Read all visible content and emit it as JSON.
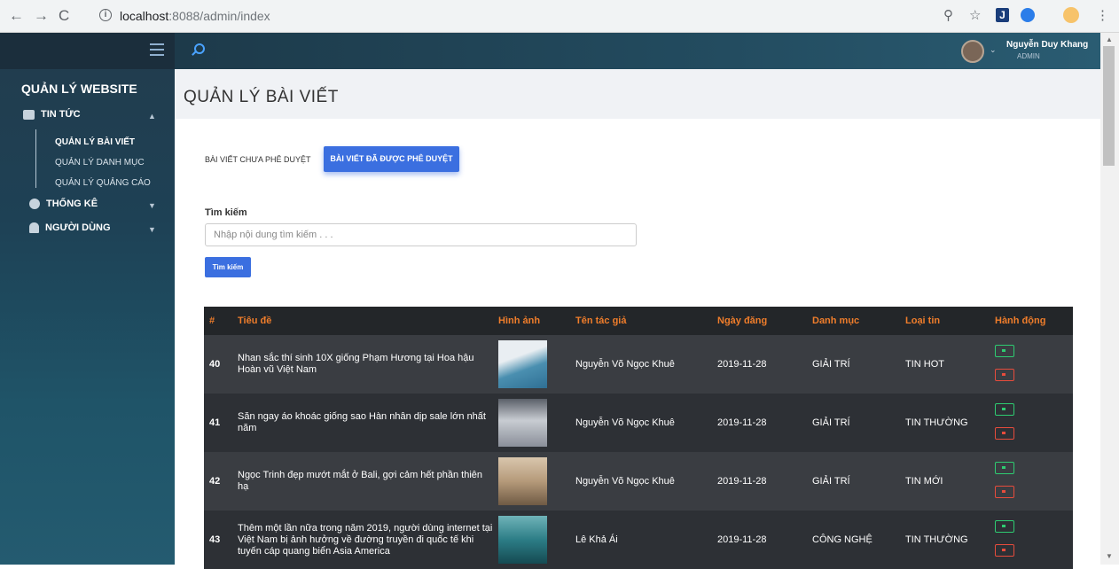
{
  "browser": {
    "url_host": "localhost",
    "url_path": ":8088/admin/index"
  },
  "sidebar": {
    "title": "QUẢN LÝ WEBSITE",
    "items": [
      {
        "label": "TIN TỨC"
      },
      {
        "label": "THỐNG KÊ"
      },
      {
        "label": "NGƯỜI DÙNG"
      }
    ],
    "sub_items": [
      {
        "label": "QUẢN LÝ BÀI VIẾT"
      },
      {
        "label": "QUẢN LÝ DANH MỤC"
      },
      {
        "label": "QUẢN LÝ QUẢNG CÁO"
      }
    ]
  },
  "topbar": {
    "user_name": "Nguyễn Duy Khang",
    "user_role": "ADMIN"
  },
  "main": {
    "page_title": "QUẢN LÝ BÀI VIẾT",
    "tab_pending": "BÀI VIẾT CHƯA PHÊ DUYỆT",
    "tab_approved": "BÀI VIẾT ĐÃ ĐƯỢC PHÊ DUYỆT",
    "search_label": "Tìm kiếm",
    "search_placeholder": "Nhập nội dung tìm kiếm . . .",
    "search_button": "Tìm kiếm"
  },
  "table": {
    "headers": [
      "#",
      "Tiêu đề",
      "Hình ảnh",
      "Tên tác giả",
      "Ngày đăng",
      "Danh mục",
      "Loại tin",
      "Hành động"
    ],
    "rows": [
      {
        "id": "40",
        "title": "Nhan sắc thí sinh 10X giống Phạm Hương tại Hoa hậu Hoàn vũ Việt Nam",
        "author": "Nguyễn Võ Ngọc Khuê",
        "date": "2019-11-28",
        "category": "GIẢI TRÍ",
        "type": "TIN HOT",
        "img_color": "#4a8fb0"
      },
      {
        "id": "41",
        "title": "Săn ngay áo khoác giống sao Hàn nhân dịp sale lớn nhất năm",
        "author": "Nguyễn Võ Ngọc Khuê",
        "date": "2019-11-28",
        "category": "GIẢI TRÍ",
        "type": "TIN THƯỜNG",
        "img_color": "#8a8f99"
      },
      {
        "id": "42",
        "title": "Ngọc Trinh đẹp mướt mắt ở Bali, gợi cảm hết phần thiên hạ",
        "author": "Nguyễn Võ Ngọc Khuê",
        "date": "2019-11-28",
        "category": "GIẢI TRÍ",
        "type": "TIN MỚI",
        "img_color": "#b59a7a"
      },
      {
        "id": "43",
        "title": "Thêm một lần nữa trong năm 2019, người dùng internet tại Việt Nam bị ảnh hưởng về đường truyền đi quốc tế khi tuyến cáp quang biển Asia America",
        "author": "Lê Khả Ái",
        "date": "2019-11-28",
        "category": "CÔNG NGHỆ",
        "type": "TIN THƯỜNG",
        "img_color": "#2c7d86"
      }
    ]
  }
}
